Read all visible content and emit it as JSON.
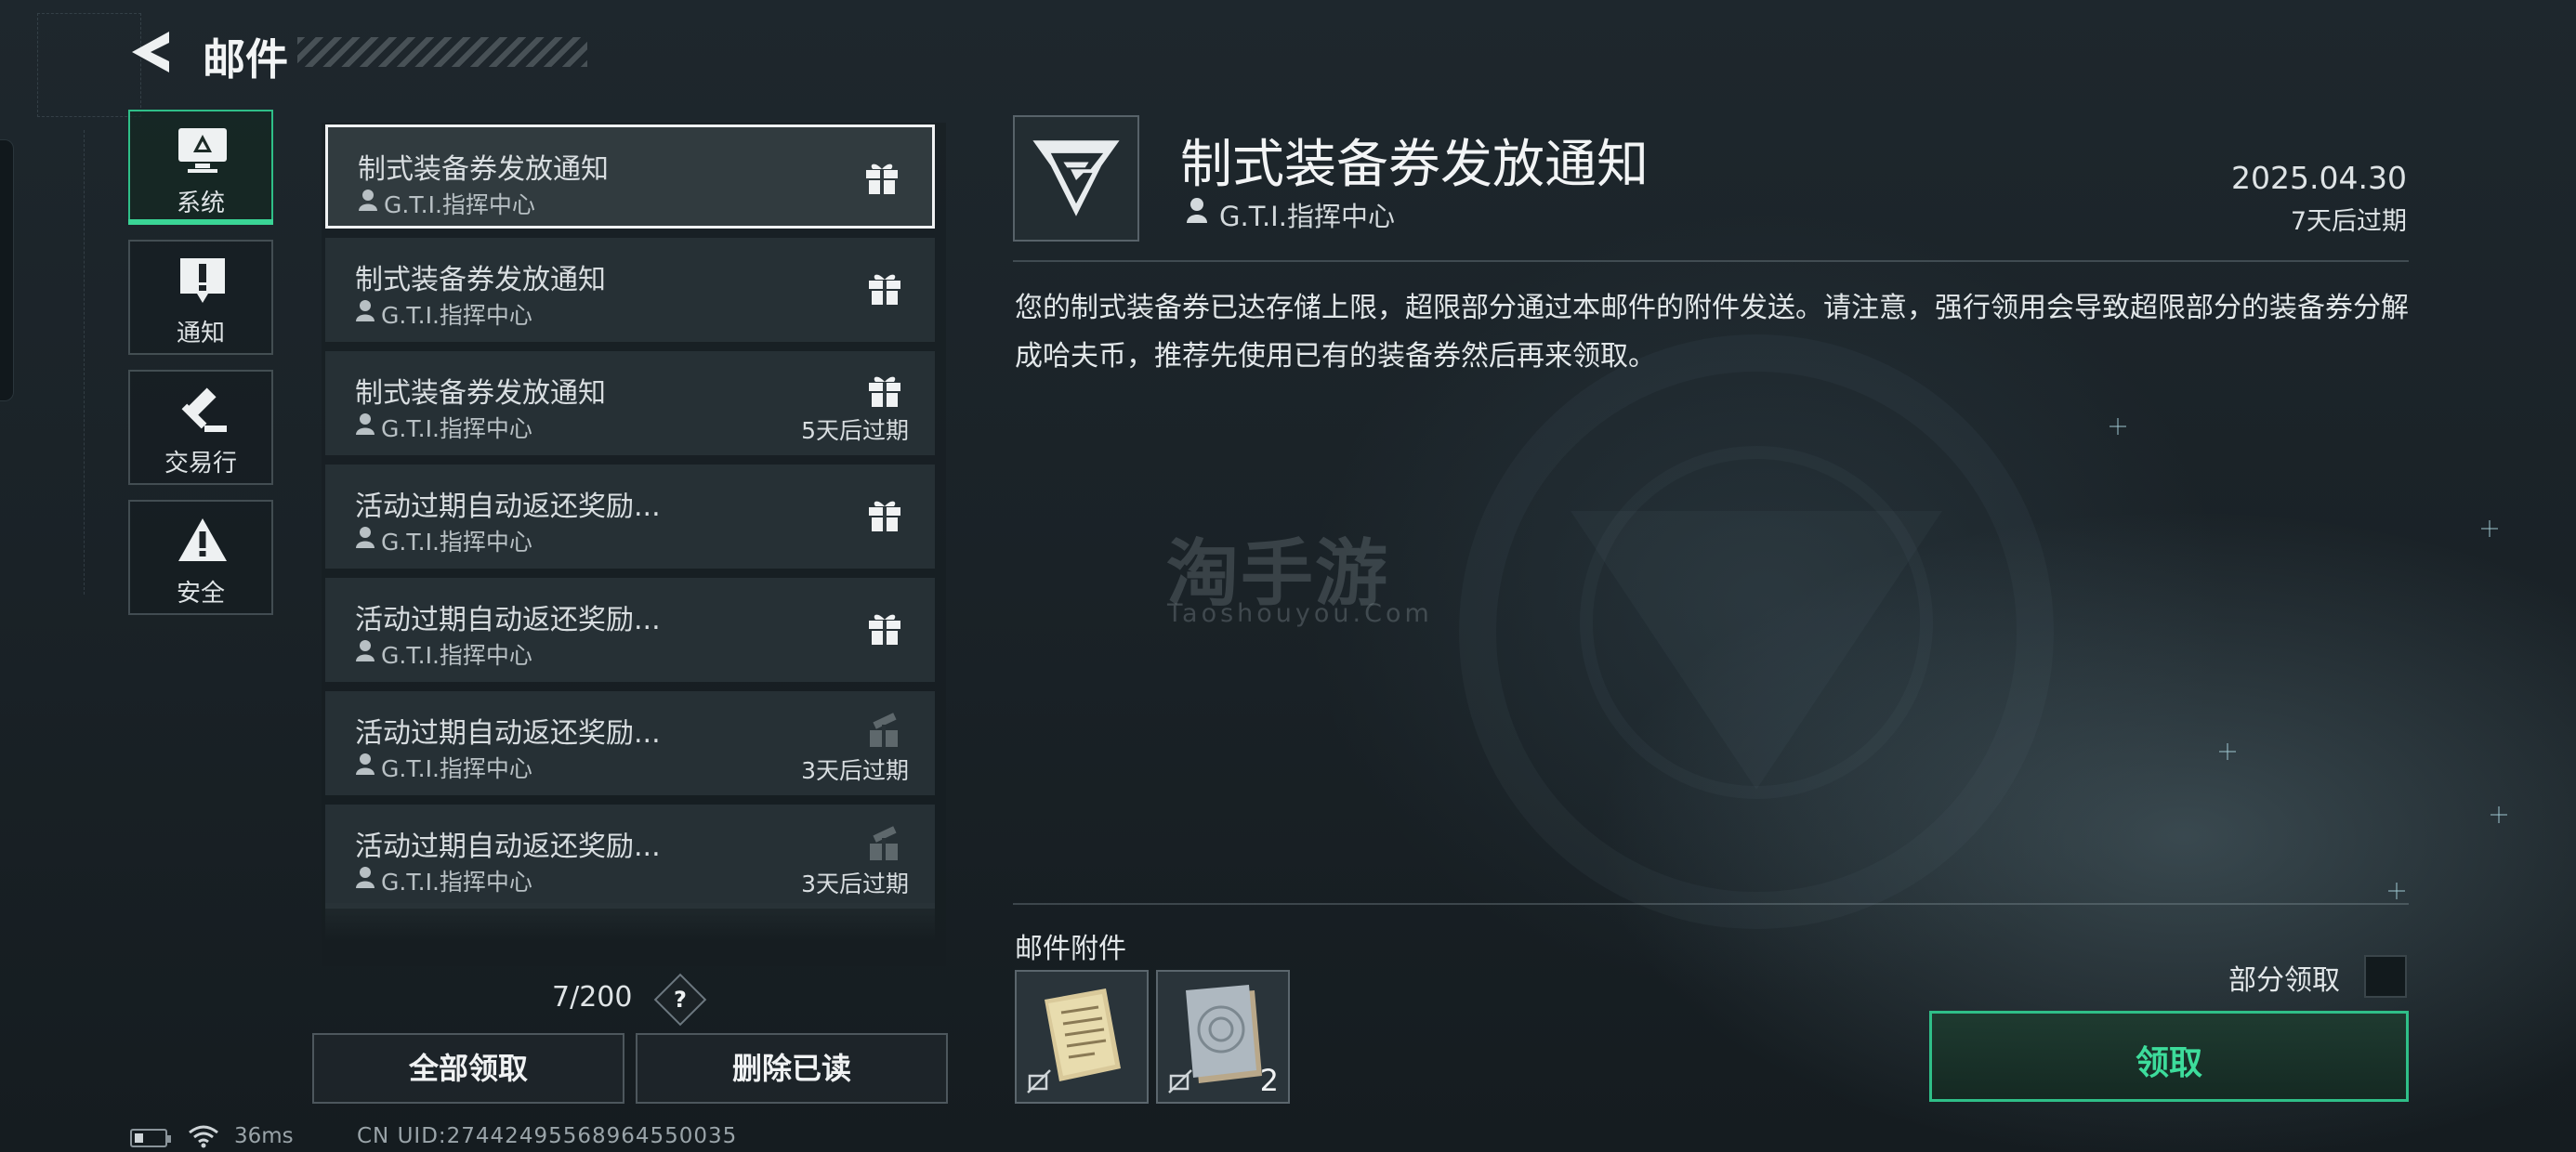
{
  "header": {
    "title": "邮件"
  },
  "categories": [
    {
      "label": "系统",
      "icon": "monitor-icon",
      "active": true
    },
    {
      "label": "通知",
      "icon": "exclamation-icon",
      "active": false
    },
    {
      "label": "交易行",
      "icon": "gavel-icon",
      "active": false
    },
    {
      "label": "安全",
      "icon": "warning-icon",
      "active": false
    }
  ],
  "mails": [
    {
      "title": "制式装备券发放通知",
      "sender": "G.T.I.指挥中心",
      "expire": "",
      "attachment": "gift",
      "selected": true
    },
    {
      "title": "制式装备券发放通知",
      "sender": "G.T.I.指挥中心",
      "expire": "",
      "attachment": "gift"
    },
    {
      "title": "制式装备券发放通知",
      "sender": "G.T.I.指挥中心",
      "expire": "5天后过期",
      "attachment": "gift"
    },
    {
      "title": "活动过期自动返还奖励...",
      "sender": "G.T.I.指挥中心",
      "expire": "",
      "attachment": "gift"
    },
    {
      "title": "活动过期自动返还奖励...",
      "sender": "G.T.I.指挥中心",
      "expire": "",
      "attachment": "gift"
    },
    {
      "title": "活动过期自动返还奖励...",
      "sender": "G.T.I.指挥中心",
      "expire": "3天后过期",
      "attachment": "gift-claimed"
    },
    {
      "title": "活动过期自动返还奖励...",
      "sender": "G.T.I.指挥中心",
      "expire": "3天后过期",
      "attachment": "gift-claimed"
    }
  ],
  "list_footer": {
    "count": "7/200",
    "help": "?",
    "claim_all": "全部领取",
    "delete_read": "删除已读"
  },
  "status_bar": {
    "ping": "36ms",
    "uid": "CN UID:27442495568964550035"
  },
  "detail": {
    "title": "制式装备券发放通知",
    "sender": "G.T.I.指挥中心",
    "date": "2025.04.30",
    "expire": "7天后过期",
    "body": "您的制式装备券已达存储上限，超限部分通过本邮件的附件发送。请注意，强行领用会导致超限部分的装备券分解成哈夫币，推荐先使用已有的装备券然后再来领取。",
    "attachments_label": "邮件附件",
    "attachments": [
      {
        "name": "document-item",
        "qty": ""
      },
      {
        "name": "voucher-item",
        "qty": "2"
      }
    ],
    "partial_claim_label": "部分领取",
    "claim_button": "领取"
  },
  "watermark": {
    "brand": "淘手游",
    "site": "Taoshouyou.Com"
  },
  "colors": {
    "accent": "#2fbf88",
    "accent_text": "#3ddc9b",
    "background": "#1c252a"
  }
}
